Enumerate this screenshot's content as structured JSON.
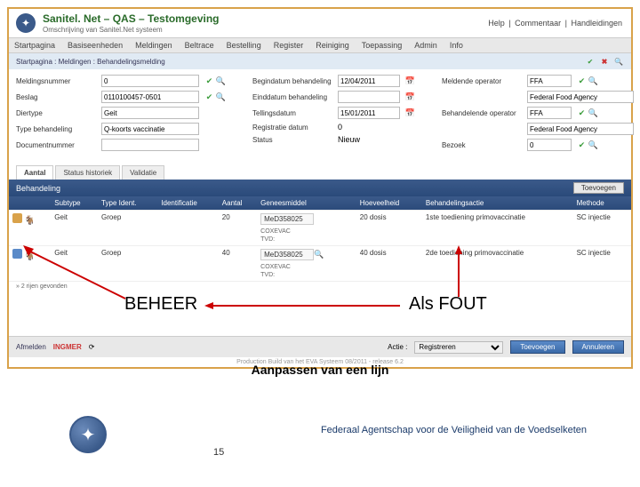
{
  "header": {
    "title": "Sanitel. Net – QAS – Testomgeving",
    "subtitle": "Omschrijving van Sanitel.Net systeem",
    "help": [
      "Help",
      "Commentaar",
      "Handleidingen"
    ]
  },
  "menu": [
    "Startpagina",
    "Basiseenheden",
    "Meldingen",
    "Beltrace",
    "Bestelling",
    "Register",
    "Reiniging",
    "Toepassing",
    "Admin",
    "Info"
  ],
  "breadcrumb": "Startpagina : Meldingen : Behandelingsmelding",
  "form": {
    "col1": {
      "meldingsnummer_label": "Meldingsnummer",
      "meldingsnummer": "0",
      "beslag_label": "Beslag",
      "beslag": "0110100457-0501",
      "diertype_label": "Diertype",
      "diertype": "Geit",
      "type_label": "Type behandeling",
      "type": "Q-koorts vaccinatie",
      "docnr_label": "Documentnummer",
      "docnr": ""
    },
    "col2": {
      "begin_label": "Begindatum behandeling",
      "begin": "12/04/2011",
      "eind_label": "Einddatum behandeling",
      "eind": "",
      "telling_label": "Tellingsdatum",
      "telling": "15/01/2011",
      "reg_label": "Registratie datum",
      "reg": "0",
      "status_label": "Status",
      "status": "Nieuw"
    },
    "col3": {
      "meldende_label": "Meldende operator",
      "meldende": "FFA",
      "meldende2": "Federal Food Agency",
      "behand_label": "Behandelende operator",
      "behand": "FFA",
      "behand2": "Federal Food Agency",
      "bezoek_label": "Bezoek",
      "bezoek": "0"
    }
  },
  "tabs": [
    "Aantal",
    "Status historiek",
    "Validatie"
  ],
  "section": {
    "title": "Behandeling",
    "add_btn": "Toevoegen"
  },
  "table": {
    "headers": [
      "",
      "Subtype",
      "Type Ident.",
      "Identificatie",
      "Aantal",
      "Geneesmiddel",
      "Hoeveelheid",
      "Behandelingsactie",
      "Methode"
    ],
    "rows": [
      {
        "subtype": "Geit",
        "typeident": "Groep",
        "ident": "",
        "aantal": "20",
        "med1": "MeD358025",
        "med2": "COXEVAC",
        "tvd": "TVD:",
        "hoev": "20 dosis",
        "actie": "1ste toediening primovaccinatie",
        "meth": "SC injectie"
      },
      {
        "subtype": "Geit",
        "typeident": "Groep",
        "ident": "",
        "aantal": "40",
        "med1": "MeD358025",
        "med2": "COXEVAC",
        "tvd": "TVD:",
        "hoev": "40 dosis",
        "actie": "2de toediening primovaccinatie",
        "meth": "SC injectie"
      }
    ],
    "footer_note": "» 2 rijen gevonden"
  },
  "footer": {
    "afmelden": "Afmelden",
    "user": "INGMER",
    "actie_label": "Actie :",
    "actie_value": "Registreren",
    "btn_toevoegen": "Toevoegen",
    "btn_annuleren": "Annuleren"
  },
  "build": "Production Build van het EVA Systeem 08/2011 - release 6.2",
  "annotations": {
    "beheer": "BEHEER",
    "als_fout": "Als FOUT",
    "caption": "Aanpassen van een lijn",
    "footer_text": "Federaal Agentschap voor de Veiligheid van de Voedselketen",
    "page": "15"
  }
}
